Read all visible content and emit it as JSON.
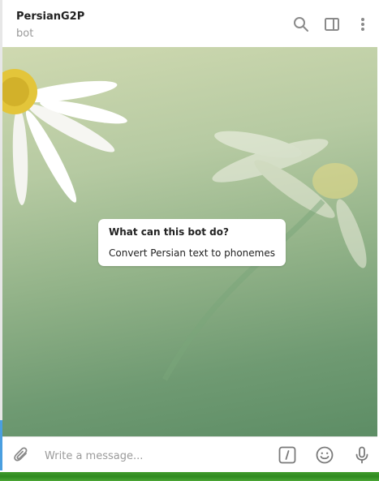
{
  "header": {
    "title": "PersianG2P",
    "subtitle": "bot",
    "icons": [
      "search-icon",
      "sidebar-panel-icon",
      "more-vertical-icon"
    ]
  },
  "info_card": {
    "title": "What can this bot do?",
    "description": "Convert Persian text to phonemes"
  },
  "composer": {
    "placeholder": "Write a message...",
    "icons": [
      "attach-icon",
      "bot-command-icon",
      "emoji-icon",
      "microphone-icon"
    ]
  },
  "colors": {
    "accent": "#4a9fe0",
    "icon_gray": "#8a8a8a",
    "wallpaper_dark": "#5d8d65",
    "wallpaper_light": "#cfd9b0"
  }
}
